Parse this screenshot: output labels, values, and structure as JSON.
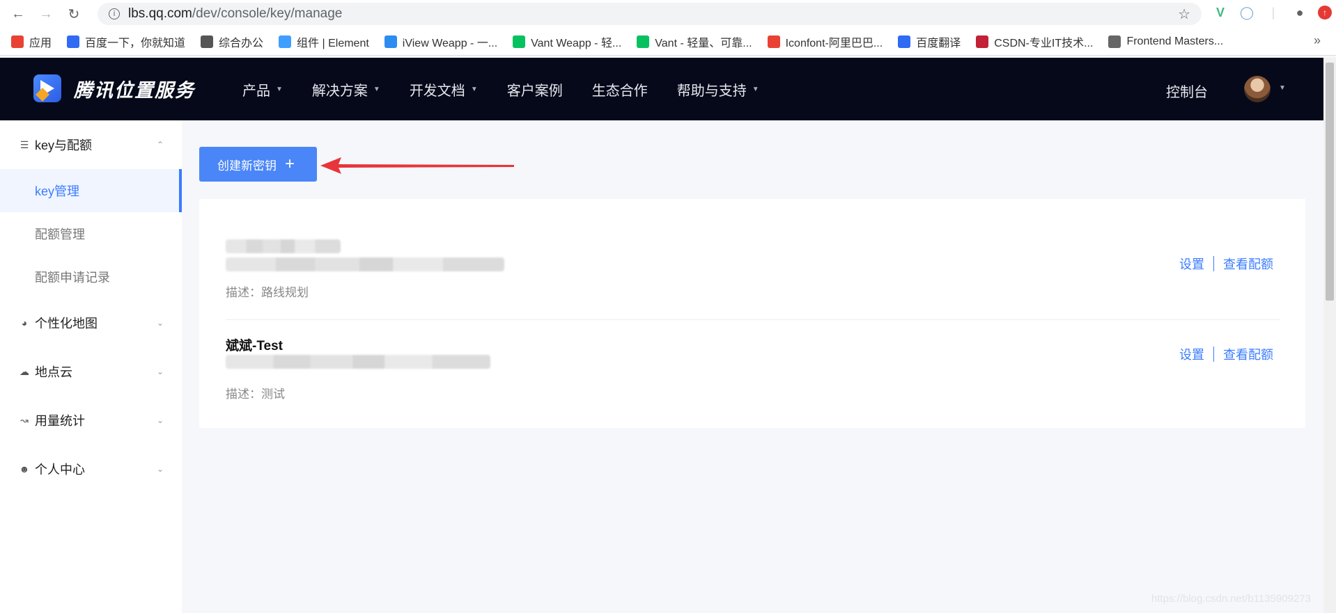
{
  "browser": {
    "url_host": "lbs.qq.com",
    "url_path": "/dev/console/key/manage",
    "bookmarks": [
      {
        "label": "应用",
        "color": "#e94235"
      },
      {
        "label": "百度一下，你就知道",
        "color": "#2f6bf3"
      },
      {
        "label": "综合办公",
        "color": "#555"
      },
      {
        "label": "组件 | Element",
        "color": "#409eff"
      },
      {
        "label": "iView Weapp - 一...",
        "color": "#2d8cf0"
      },
      {
        "label": "Vant Weapp - 轻...",
        "color": "#07c160"
      },
      {
        "label": "Vant - 轻量、可靠...",
        "color": "#07c160"
      },
      {
        "label": "Iconfont-阿里巴巴...",
        "color": "#e94235"
      },
      {
        "label": "百度翻译",
        "color": "#2f6bf3"
      },
      {
        "label": "CSDN-专业IT技术...",
        "color": "#c32136"
      },
      {
        "label": "Frontend Masters...",
        "color": "#666"
      }
    ],
    "bookmark_more": "»"
  },
  "header": {
    "logo_text": "腾讯位置服务",
    "nav": [
      {
        "label": "产品",
        "has_caret": true
      },
      {
        "label": "解决方案",
        "has_caret": true
      },
      {
        "label": "开发文档",
        "has_caret": true
      },
      {
        "label": "客户案例",
        "has_caret": false
      },
      {
        "label": "生态合作",
        "has_caret": false
      },
      {
        "label": "帮助与支持",
        "has_caret": true
      }
    ],
    "console": "控制台"
  },
  "sidebar": {
    "group_key": "key与配额",
    "items": [
      "key管理",
      "配额管理",
      "配额申请记录"
    ],
    "groups": [
      "个性化地图",
      "地点云",
      "用量统计",
      "个人中心"
    ]
  },
  "main": {
    "create_button": "创建新密钥",
    "keys": [
      {
        "name": "",
        "description": "描述：路线规划",
        "settings": "设置",
        "view_quota": "查看配额"
      },
      {
        "name": "斌斌-Test",
        "description": "描述：测试",
        "settings": "设置",
        "view_quota": "查看配额"
      }
    ]
  },
  "watermark": "https://blog.csdn.net/b1135909273",
  "colors": {
    "accent": "#3b7cff",
    "header_bg": "#05091a",
    "button_bg": "#4a86f7",
    "arrow": "#e8343a"
  }
}
